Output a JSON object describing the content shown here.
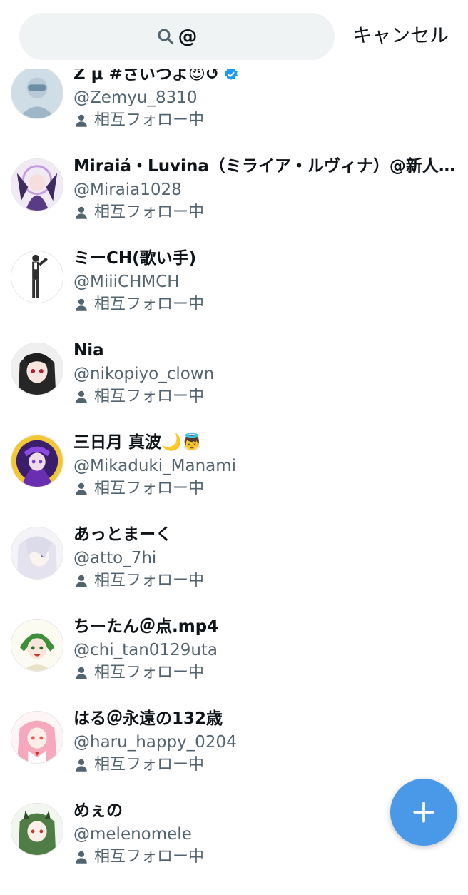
{
  "search": {
    "query": "@",
    "cancel_label": "キャンセル"
  },
  "mutual_label": "相互フォロー中",
  "users": [
    {
      "name": "Z μ #さいつよ😈↺",
      "handle": "@Zemyu_8310",
      "verified": true
    },
    {
      "name": "Miraiá・Luvina（ミライア・ルヴィナ）@新人…",
      "handle": "@Miraia1028",
      "verified": false
    },
    {
      "name": "ミーCH(歌い手)",
      "handle": "@MiiiCHMCH",
      "verified": false
    },
    {
      "name": "Nia",
      "handle": "@nikopiyo_clown",
      "verified": false
    },
    {
      "name": "三日月 真波🌙👼",
      "handle": "@Mikaduki_Manami",
      "verified": false
    },
    {
      "name": "あっとまーく",
      "handle": "@atto_7hi",
      "verified": false
    },
    {
      "name": "ちーたん＠点.mp4",
      "handle": "@chi_tan0129uta",
      "verified": false
    },
    {
      "name": "はる＠永遠の132歳",
      "handle": "@haru_happy_0204",
      "verified": false
    },
    {
      "name": "めぇの",
      "handle": "@melenomele",
      "verified": false
    }
  ],
  "colors": {
    "accent": "#4a99e9",
    "verified": "#1d9bf0",
    "secondary_text": "#536471",
    "search_bg": "#eff3f4"
  },
  "icons": {
    "search": "search-icon",
    "verified": "verified-badge-icon",
    "mutual": "person-icon",
    "compose": "plus-icon"
  }
}
